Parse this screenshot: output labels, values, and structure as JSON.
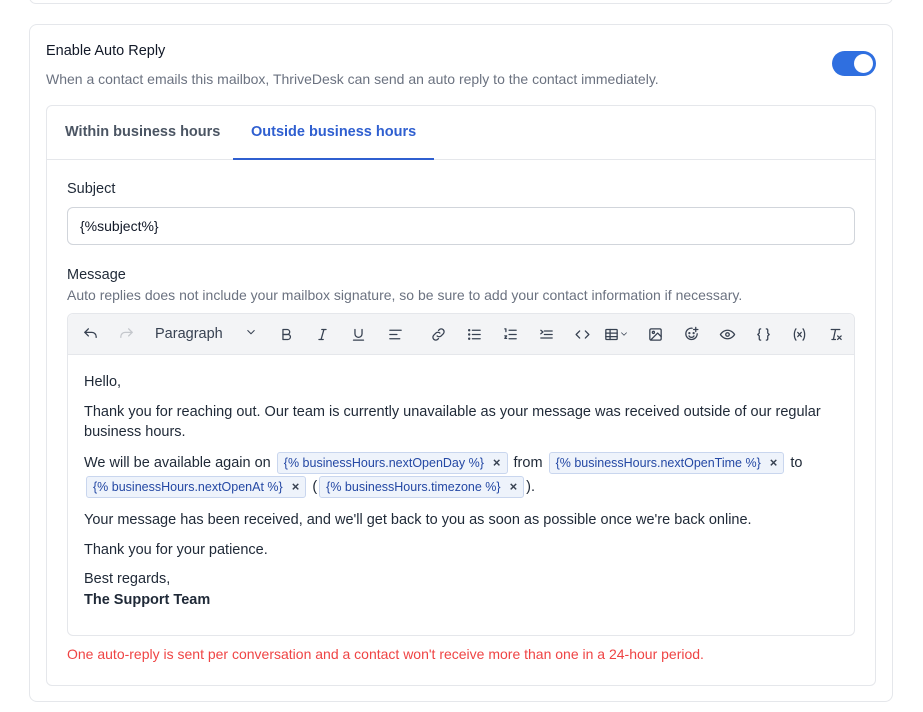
{
  "header": {
    "title": "Enable Auto Reply",
    "description": "When a contact emails this mailbox, ThriveDesk can send an auto reply to the contact immediately.",
    "toggle_on": true
  },
  "tabs": [
    {
      "label": "Within business hours",
      "active": false
    },
    {
      "label": "Outside business hours",
      "active": true
    }
  ],
  "subject": {
    "label": "Subject",
    "value": "{%subject%}"
  },
  "message": {
    "label": "Message",
    "help": "Auto replies does not include your mailbox signature, so be sure to add your contact information if necessary."
  },
  "toolbar": {
    "paragraph_label": "Paragraph",
    "icons": [
      "undo-icon",
      "redo-icon",
      "bold-icon",
      "italic-icon",
      "underline-icon",
      "align-icon",
      "link-icon",
      "bullet-list-icon",
      "ordered-list-icon",
      "indent-icon",
      "code-icon",
      "table-icon",
      "image-icon",
      "emoji-icon",
      "preview-icon",
      "braces-icon",
      "variable-icon",
      "clear-format-icon"
    ]
  },
  "body": {
    "greeting": "Hello,",
    "para1": "Thank you for reaching out. Our team is currently unavailable as your message was received outside of our regular business hours.",
    "avail_prefix": "We will be available again on",
    "chip1": "{% businessHours.nextOpenDay %}",
    "from": "from",
    "chip2": "{% businessHours.nextOpenTime %}",
    "to": "to",
    "chip3": "{% businessHours.nextOpenAt %}",
    "open_paren": "(",
    "chip4": "{% businessHours.timezone %}",
    "close_paren": ").",
    "para3": "Your message has been received, and we'll get back to you as soon as possible once we're back online.",
    "para4": "Thank you for your patience.",
    "regards": "Best regards,",
    "signature": "The Support Team",
    "chip_remove": "×"
  },
  "footer_note": "One auto-reply is sent per conversation and a contact won't receive more than one in a 24-hour period.",
  "colors": {
    "accent": "#2f6fe0",
    "tab_active": "#2f5fd0",
    "warning": "#ef4444"
  }
}
